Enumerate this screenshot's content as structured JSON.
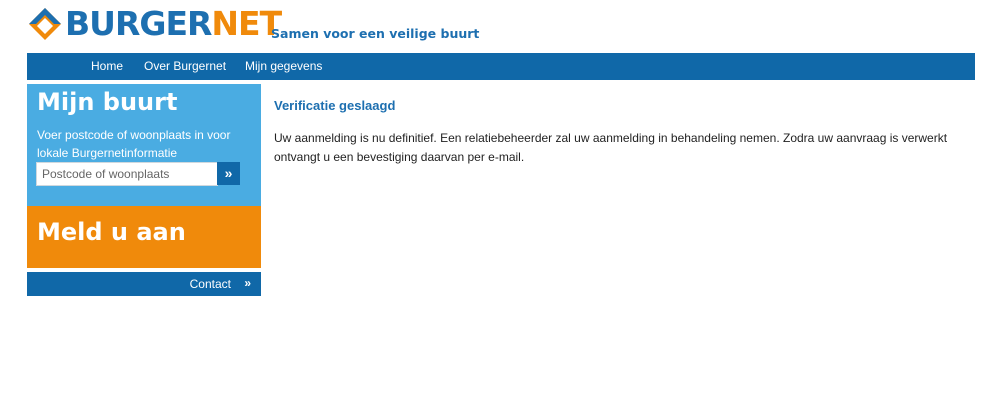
{
  "header": {
    "logo_part1": "BURGER",
    "logo_part2": "NET",
    "tagline": "Samen voor een veilige buurt"
  },
  "nav": {
    "items": [
      {
        "label": "Home"
      },
      {
        "label": "Over Burgernet"
      },
      {
        "label": "Mijn gegevens"
      }
    ]
  },
  "sidebar": {
    "buurt": {
      "title": "Mijn buurt",
      "description": "Voer postcode of woonplaats in voor lokale Burgernetinformatie",
      "input_placeholder": "Postcode of woonplaats",
      "input_value": "",
      "go_icon": "double-chevron-right-icon"
    },
    "meld": {
      "title": "Meld u aan"
    },
    "contact": {
      "label": "Contact",
      "icon": "double-chevron-right-icon"
    }
  },
  "main": {
    "title": "Verificatie geslaagd",
    "body": "Uw aanmelding is nu definitief. Een relatiebeheerder zal uw aanmelding in behandeling nemen. Zodra uw aanvraag is verwerkt ontvangt u een bevestiging daarvan per e-mail."
  },
  "colors": {
    "brand_blue": "#1068a8",
    "light_blue": "#4aace2",
    "brand_orange": "#f08a0b"
  }
}
